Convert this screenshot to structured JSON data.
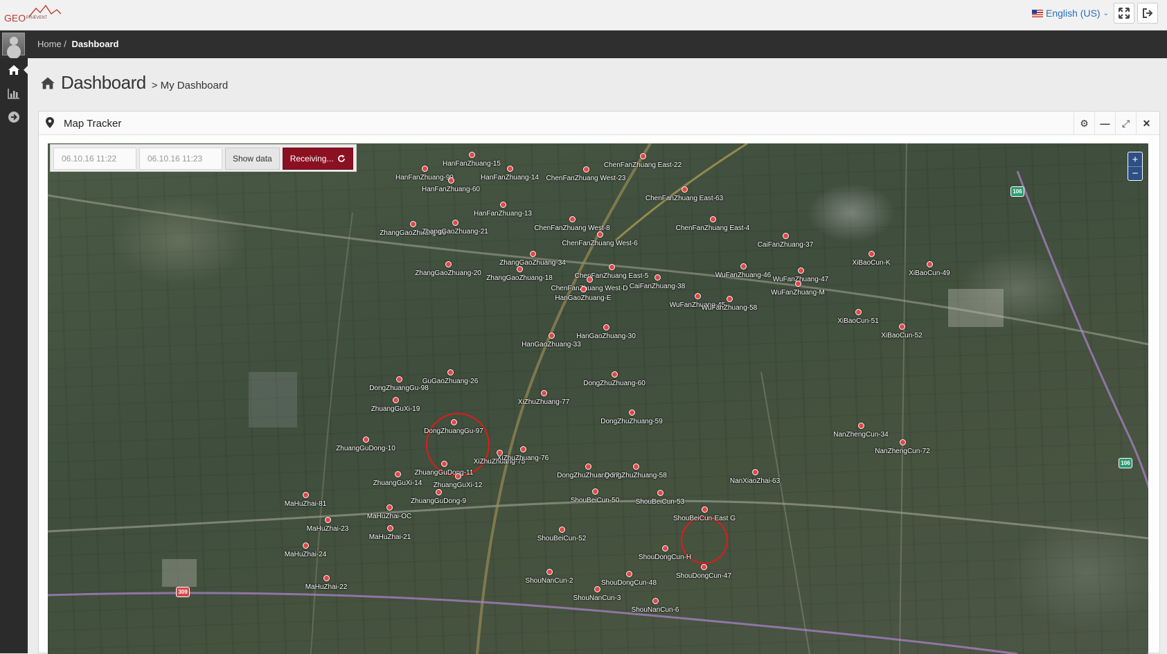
{
  "logo": {
    "text": "GEO",
    "sub": "PRÆVENT"
  },
  "header": {
    "language": "English (US)"
  },
  "breadcrumb": {
    "home": "Home",
    "current": "Dashboard"
  },
  "page": {
    "title": "Dashboard",
    "subtitle": "> My Dashboard"
  },
  "widget": {
    "title": "Map Tracker"
  },
  "controls": {
    "from": "06.10.16 11:22",
    "to": "06.10.16 11:23",
    "show_label": "Show data",
    "receiving_label": "Receiving..."
  },
  "map": {
    "road_shields": [
      "106",
      "106",
      "309"
    ],
    "markers": [
      "HanFanZhuang-15",
      "HanFanZhuang-99",
      "HanFanZhuang-14",
      "ChenFanZhuang West-23",
      "ChenFanZhuang East-22",
      "HanFanZhuang-60",
      "ChenFanZhuang East-63",
      "HanFanZhuang-13",
      "ChenFanZhuang West-8",
      "ChenFanZhuang East-4",
      "ZhangGaoZhuang-56",
      "ZhangGaoZhuang-21",
      "ChenFanZhuang West-6",
      "CaiFanZhuang-37",
      "ZhangGaoZhuang-34",
      "ZhangGaoZhuang-20",
      "ZhangGaoZhuang-18",
      "ChenFanZhuang East-5",
      "WuFanZhuang-46",
      "WuFanZhuang-47",
      "XiBaoCun-K",
      "XiBaoCun-49",
      "ChenFanZhuang West-D",
      "CaiFanZhuang-38",
      "WuFanZhuang-M",
      "HanGaoZhuang-E",
      "WuFanZhuang-45",
      "WuFanZhuang-58",
      "XiBaoCun-51",
      "XiBaoCun-52",
      "HanGaoZhuang-30",
      "HanGaoZhuang-33",
      "GuGaoZhuang-26",
      "DongZhuangGu-98",
      "DongZhuZhuang-60",
      "XiZhuZhuang-77",
      "ZhuangGuXi-19",
      "DongZhuZhuang-59",
      "DongZhuangGu-97",
      "NanZhengCun-34",
      "NanZhengCun-72",
      "ZhuangGuDong-10",
      "XiZhuZhuang-75",
      "XiZhuZhuang-76",
      "ZhuangGuDong-11",
      "DongZhuZhuang-57",
      "DongZhuZhuang-58",
      "NanXiaoZhai-63",
      "ZhuangGuXi-14",
      "ZhuangGuXi-12",
      "ShouBeiCun-50",
      "ShouBeiCun-53",
      "MaHuZhai-81",
      "ZhuangGuDong-9",
      "ShouBeiCun-East G",
      "MaHuZhai-OC",
      "MaHuZhai-23",
      "MaHuZhai-21",
      "ShouBeiCun-52",
      "MaHuZhai-24",
      "ShouDongCun-H",
      "ShouDongCun-47",
      "ShouNanCun-2",
      "ShouDongCun-48",
      "MaHuZhai-22",
      "ShouNanCun-3",
      "ShouNanCun-6"
    ]
  },
  "colors": {
    "accent": "#8b1022",
    "marker": "#e64545",
    "nav": "#2b2b2b"
  }
}
